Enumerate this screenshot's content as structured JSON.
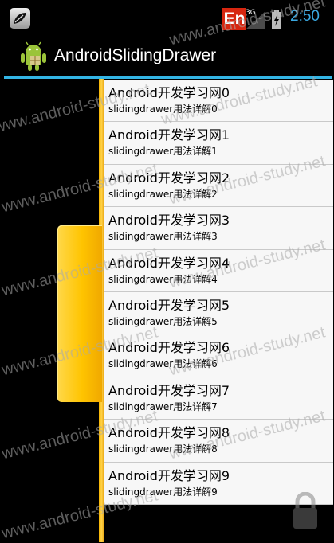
{
  "status_bar": {
    "ime_label": "En",
    "network_label": "3G",
    "time": "2:50"
  },
  "action_bar": {
    "title": "AndroidSlidingDrawer"
  },
  "list": {
    "items": [
      {
        "title": "Android开发学习网0",
        "subtitle": "slidingdrawer用法详解0"
      },
      {
        "title": "Android开发学习网1",
        "subtitle": "slidingdrawer用法详解1"
      },
      {
        "title": "Android开发学习网2",
        "subtitle": "slidingdrawer用法详解2"
      },
      {
        "title": "Android开发学习网3",
        "subtitle": "slidingdrawer用法详解3"
      },
      {
        "title": "Android开发学习网4",
        "subtitle": "slidingdrawer用法详解4"
      },
      {
        "title": "Android开发学习网5",
        "subtitle": "slidingdrawer用法详解5"
      },
      {
        "title": "Android开发学习网6",
        "subtitle": "slidingdrawer用法详解6"
      },
      {
        "title": "Android开发学习网7",
        "subtitle": "slidingdrawer用法详解7"
      },
      {
        "title": "Android开发学习网8",
        "subtitle": "slidingdrawer用法详解8"
      },
      {
        "title": "Android开发学习网9",
        "subtitle": "slidingdrawer用法详解9"
      }
    ]
  },
  "watermark": {
    "text": "www.android-study.net"
  },
  "colors": {
    "accent": "#33b5e5",
    "drawer_handle": "#ffc400",
    "clock": "#3aa8e0",
    "ime_badge": "#d7260f"
  },
  "icons": {
    "notification": "leaf-notification-icon",
    "app": "android-robot-icon",
    "battery": "charging-battery-icon",
    "signal": "signal-icon",
    "lock": "lock-icon"
  }
}
